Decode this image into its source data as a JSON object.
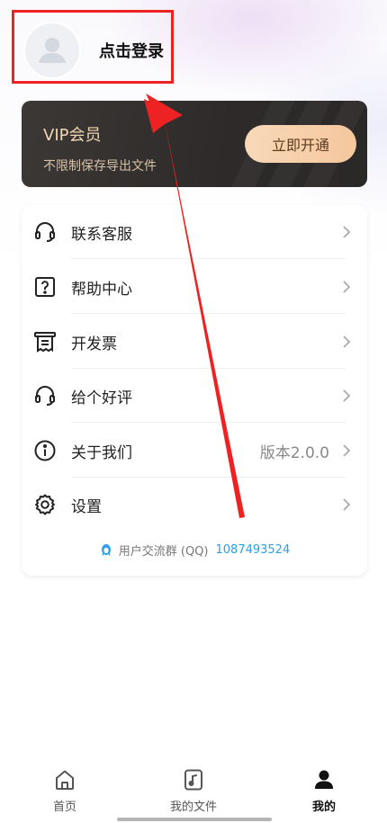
{
  "header": {
    "login_text": "点击登录"
  },
  "vip": {
    "title": "VIP会员",
    "subtitle": "不限制保存导出文件",
    "button": "立即开通"
  },
  "menu": {
    "items": [
      {
        "label": "联系客服",
        "icon": "headset-icon",
        "value": ""
      },
      {
        "label": "帮助中心",
        "icon": "help-icon",
        "value": ""
      },
      {
        "label": "开发票",
        "icon": "invoice-icon",
        "value": ""
      },
      {
        "label": "给个好评",
        "icon": "headset-icon",
        "value": ""
      },
      {
        "label": "关于我们",
        "icon": "info-icon",
        "value": "版本2.0.0"
      },
      {
        "label": "设置",
        "icon": "gear-icon",
        "value": ""
      }
    ]
  },
  "qq_group": {
    "label": "用户交流群 (QQ)",
    "number": "1087493524",
    "color": "#2aa0e6"
  },
  "tabbar": {
    "tabs": [
      {
        "label": "首页",
        "icon": "home-icon"
      },
      {
        "label": "我的文件",
        "icon": "music-file-icon"
      },
      {
        "label": "我的",
        "icon": "user-icon",
        "active": true
      }
    ]
  },
  "colors": {
    "annotation_red": "#ee2222",
    "vip_gold": "#f3d6b2",
    "vip_button": "#f5c79d"
  }
}
